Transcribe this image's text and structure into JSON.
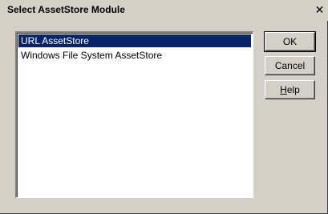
{
  "window": {
    "title": "Select AssetStore Module",
    "close_glyph": "✕"
  },
  "list": {
    "items": [
      {
        "label": "URL AssetStore",
        "selected": true
      },
      {
        "label": "Windows File System AssetStore",
        "selected": false
      }
    ]
  },
  "buttons": {
    "ok_label": "OK",
    "cancel_label": "Cancel",
    "help_label": "Help",
    "help_mnemonic": "H",
    "help_rest": "elp"
  },
  "colors": {
    "dialog_face": "#d4d0c8",
    "selection": "#0a246a",
    "list_background": "#ffffff"
  }
}
